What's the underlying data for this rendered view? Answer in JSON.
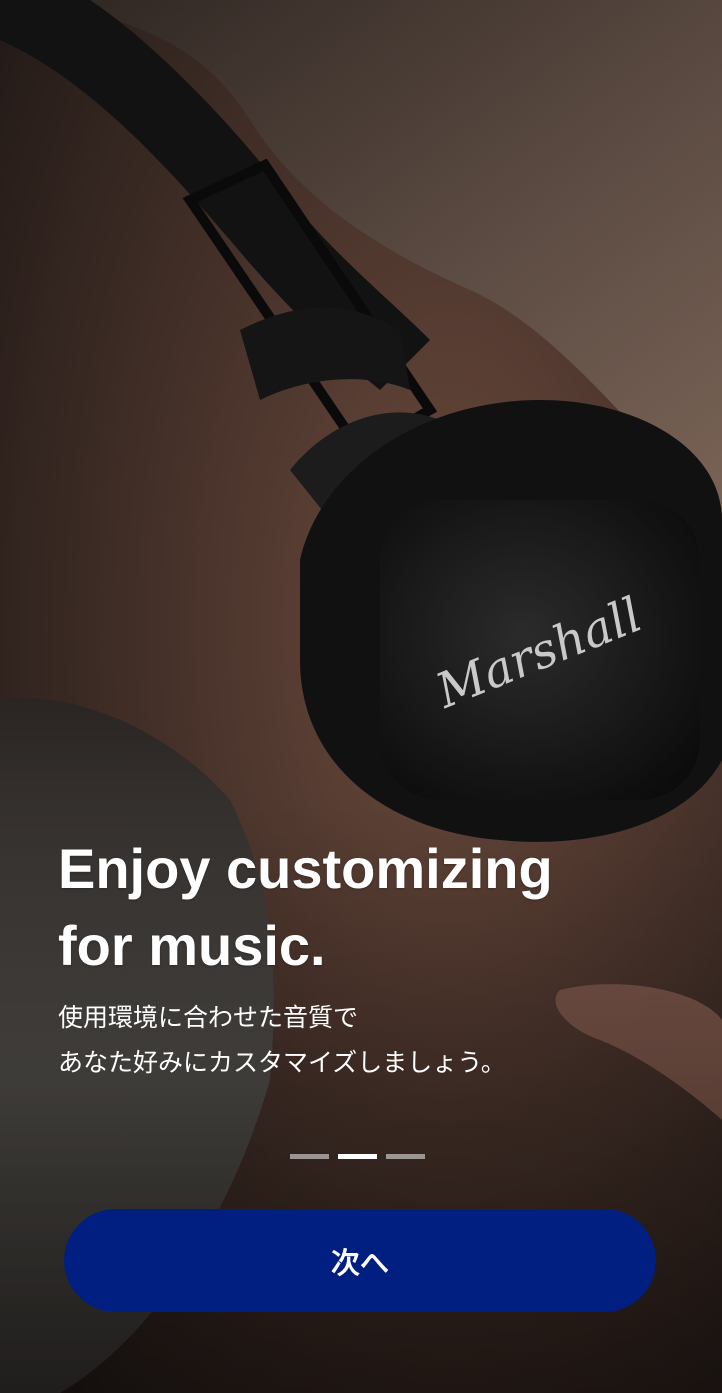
{
  "slide": {
    "headline_line1": "Enjoy customizing",
    "headline_line2": "for music.",
    "subtext_line1": "使用環境に合わせた音質で",
    "subtext_line2": "あなた好みにカスタマイズしましょう。"
  },
  "background": {
    "headphone_brand": "Marshall"
  },
  "pager": {
    "total": 3,
    "active_index": 1
  },
  "next_button": {
    "label": "次へ"
  },
  "colors": {
    "button_bg": "#001f80",
    "text": "#ffffff",
    "pager_active": "#ffffff",
    "pager_inactive": "#bdbdbd"
  }
}
